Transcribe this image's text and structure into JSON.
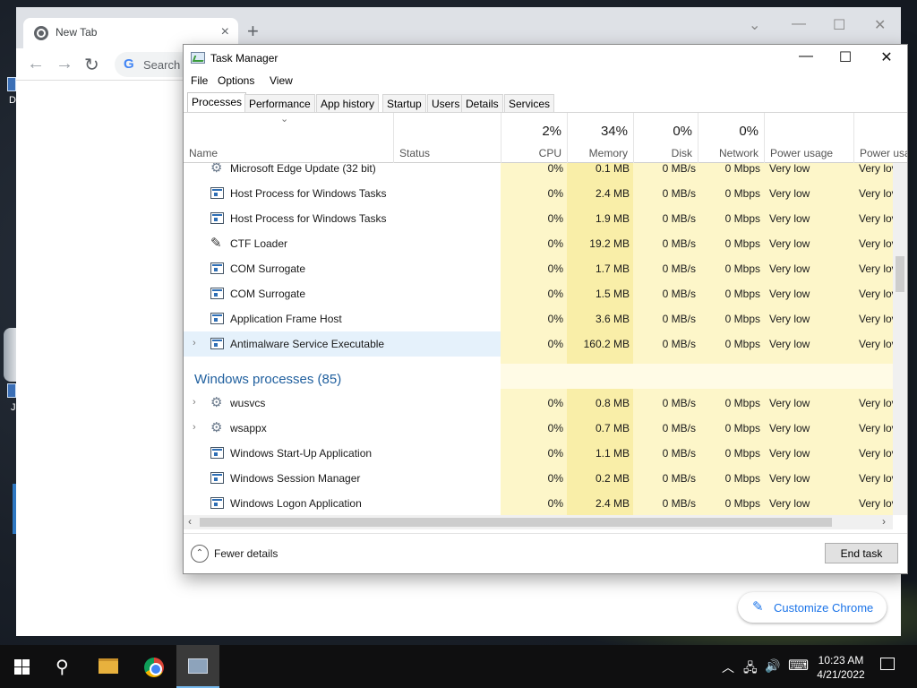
{
  "desktop": {
    "icon_labels": [
      "D",
      "J"
    ]
  },
  "chrome": {
    "tab_title": "New Tab",
    "tab_close": "×",
    "new_tab": "+",
    "controls": {
      "dropdown": "⌄",
      "minimize": "—",
      "maximize": "☐",
      "close": "✕"
    },
    "nav": {
      "back": "←",
      "forward": "→",
      "reload": "↻"
    },
    "google_logo": "G",
    "search_placeholder": "Search",
    "customize_label": "Customize Chrome"
  },
  "task_manager": {
    "title": "Task Manager",
    "controls": {
      "minimize": "—",
      "maximize": "☐",
      "close": "✕"
    },
    "menu": [
      "File",
      "Options",
      "View"
    ],
    "tabs": [
      "Processes",
      "Performance",
      "App history",
      "Startup",
      "Users",
      "Details",
      "Services"
    ],
    "active_tab": "Processes",
    "sort_arrow": "⌄",
    "columns": {
      "name": "Name",
      "status": "Status",
      "cpu": {
        "pct": "2%",
        "label": "CPU"
      },
      "memory": {
        "pct": "34%",
        "label": "Memory"
      },
      "disk": {
        "pct": "0%",
        "label": "Disk"
      },
      "network": {
        "pct": "0%",
        "label": "Network"
      },
      "power": "Power usage",
      "power_trend": "Power usa"
    },
    "rows": [
      {
        "name": "Microsoft Edge Update (32 bit)",
        "icon": "gear-icon",
        "expander": false,
        "cpu": "0%",
        "memory": "0.1 MB",
        "disk": "0 MB/s",
        "network": "0 Mbps",
        "power": "Very low",
        "power_trend": "Very lov"
      },
      {
        "name": "Host Process for Windows Tasks",
        "icon": "window-icon",
        "expander": false,
        "cpu": "0%",
        "memory": "2.4 MB",
        "disk": "0 MB/s",
        "network": "0 Mbps",
        "power": "Very low",
        "power_trend": "Very lov"
      },
      {
        "name": "Host Process for Windows Tasks",
        "icon": "window-icon",
        "expander": false,
        "cpu": "0%",
        "memory": "1.9 MB",
        "disk": "0 MB/s",
        "network": "0 Mbps",
        "power": "Very low",
        "power_trend": "Very lov"
      },
      {
        "name": "CTF Loader",
        "icon": "pen-icon",
        "expander": false,
        "cpu": "0%",
        "memory": "19.2 MB",
        "disk": "0 MB/s",
        "network": "0 Mbps",
        "power": "Very low",
        "power_trend": "Very lov"
      },
      {
        "name": "COM Surrogate",
        "icon": "window-icon",
        "expander": false,
        "cpu": "0%",
        "memory": "1.7 MB",
        "disk": "0 MB/s",
        "network": "0 Mbps",
        "power": "Very low",
        "power_trend": "Very lov"
      },
      {
        "name": "COM Surrogate",
        "icon": "window-icon",
        "expander": false,
        "cpu": "0%",
        "memory": "1.5 MB",
        "disk": "0 MB/s",
        "network": "0 Mbps",
        "power": "Very low",
        "power_trend": "Very lov"
      },
      {
        "name": "Application Frame Host",
        "icon": "window-icon",
        "expander": false,
        "cpu": "0%",
        "memory": "3.6 MB",
        "disk": "0 MB/s",
        "network": "0 Mbps",
        "power": "Very low",
        "power_trend": "Very lov"
      },
      {
        "name": "Antimalware Service Executable",
        "icon": "window-icon",
        "expander": true,
        "selected": true,
        "cpu": "0%",
        "memory": "160.2 MB",
        "disk": "0 MB/s",
        "network": "0 Mbps",
        "power": "Very low",
        "power_trend": "Very lov"
      }
    ],
    "group_title": "Windows processes (85)",
    "windows_rows": [
      {
        "name": "wusvcs",
        "icon": "gear-icon",
        "expander": true,
        "cpu": "0%",
        "memory": "0.8 MB",
        "disk": "0 MB/s",
        "network": "0 Mbps",
        "power": "Very low",
        "power_trend": "Very lov"
      },
      {
        "name": "wsappx",
        "icon": "gear-icon",
        "expander": true,
        "cpu": "0%",
        "memory": "0.7 MB",
        "disk": "0 MB/s",
        "network": "0 Mbps",
        "power": "Very low",
        "power_trend": "Very lov"
      },
      {
        "name": "Windows Start-Up Application",
        "icon": "window-icon",
        "expander": false,
        "cpu": "0%",
        "memory": "1.1 MB",
        "disk": "0 MB/s",
        "network": "0 Mbps",
        "power": "Very low",
        "power_trend": "Very lov"
      },
      {
        "name": "Windows Session Manager",
        "icon": "window-icon",
        "expander": false,
        "cpu": "0%",
        "memory": "0.2 MB",
        "disk": "0 MB/s",
        "network": "0 Mbps",
        "power": "Very low",
        "power_trend": "Very lov"
      },
      {
        "name": "Windows Logon Application",
        "icon": "window-icon",
        "expander": false,
        "cpu": "0%",
        "memory": "2.4 MB",
        "disk": "0 MB/s",
        "network": "0 Mbps",
        "power": "Very low",
        "power_trend": "Very lov"
      }
    ],
    "scroll": {
      "left": "‹",
      "right": "›"
    },
    "fewer_details": "Fewer details",
    "fewer_icon": "⌃",
    "end_task": "End task"
  },
  "taskbar": {
    "search_icon": "⚲",
    "tray": {
      "chevron": "︿",
      "network": "🖧",
      "volume": "🔊",
      "keyboard": "⌨"
    },
    "time": "10:23 AM",
    "date": "4/21/2022"
  },
  "colors": {
    "accent": "#1f5f9e",
    "heat_cell": "#fdf6c9",
    "heat_cell_strong": "#f9eea8",
    "selected_row": "#e5f1fb",
    "taskbar": "#0f0f10"
  }
}
